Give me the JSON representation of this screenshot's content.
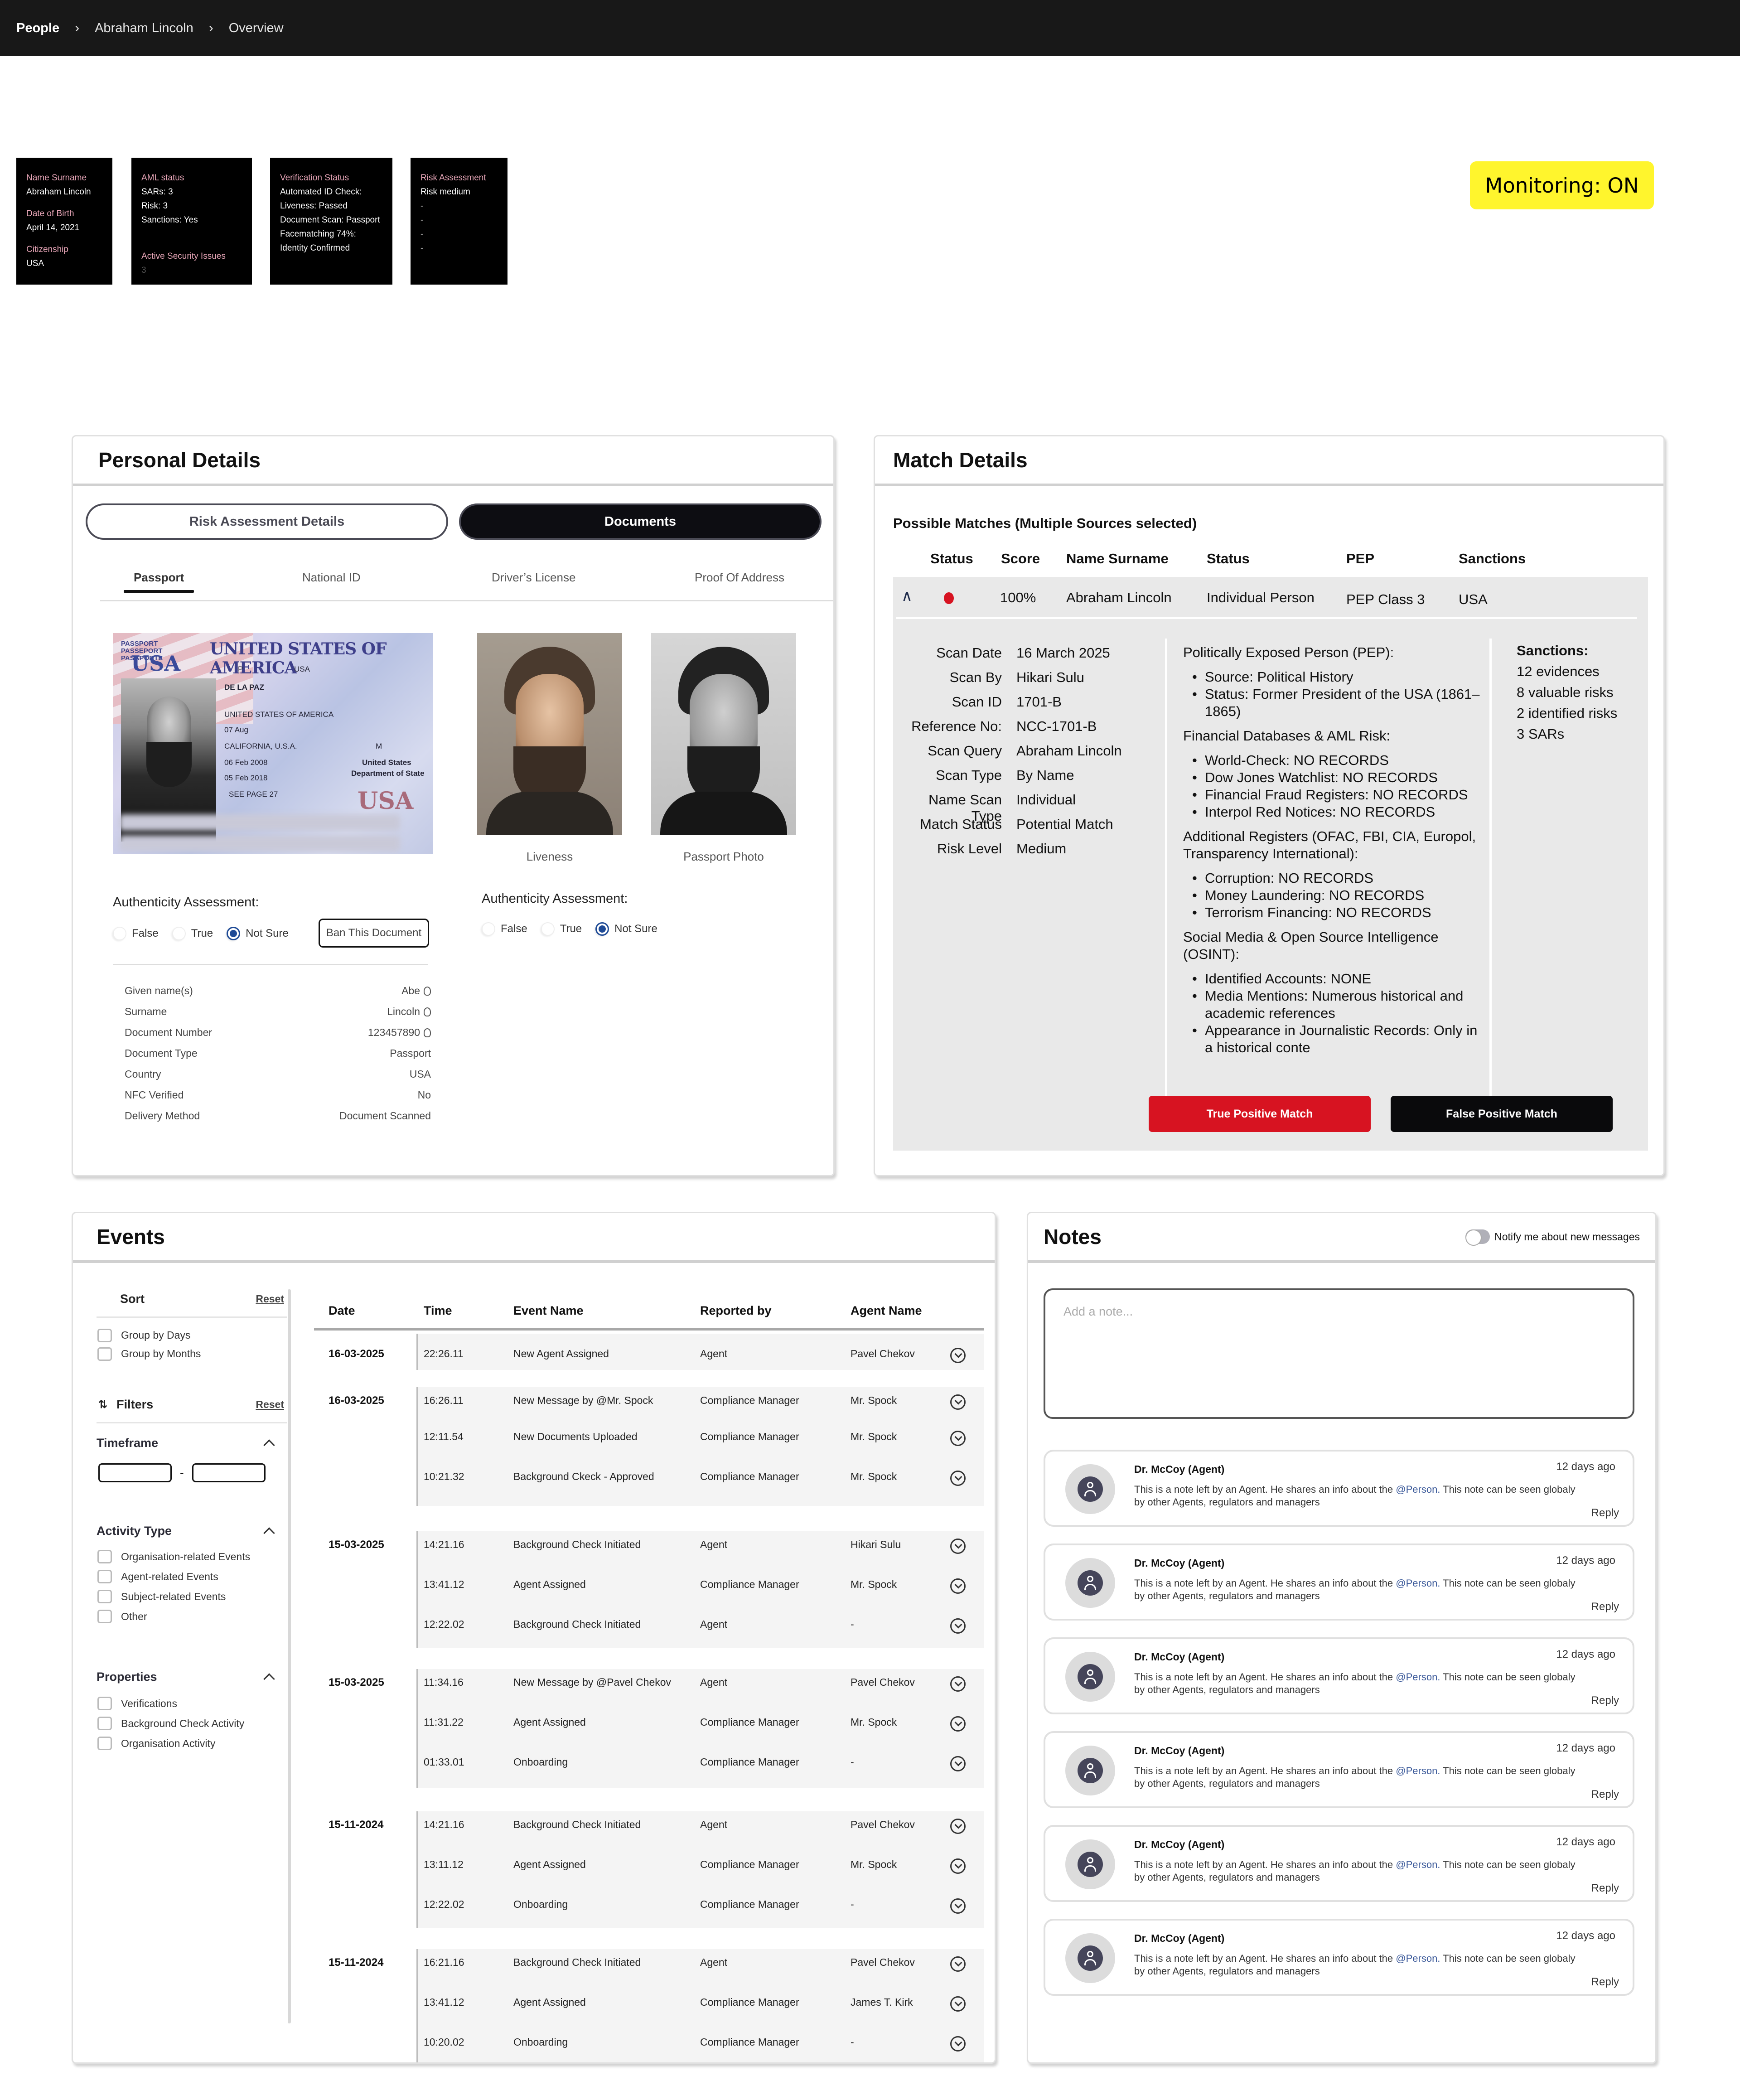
{
  "breadcrumb": [
    "People",
    "Abraham Lincoln",
    "Overview"
  ],
  "summary_cards": {
    "identity": {
      "name_label": "Name Surname",
      "name_value": "Abraham Lincoln",
      "dob_label": "Date of Birth",
      "dob_value": "April 14, 2021",
      "citizenship_label": "Citizenship",
      "citizenship_value": "USA"
    },
    "aml": {
      "title": "AML status",
      "lines": [
        "SARs: 3",
        "Risk: 3",
        "Sanctions: Yes"
      ],
      "security_label": "Active Security Issues",
      "security_value": "3"
    },
    "verification": {
      "title": "Verification Status",
      "lines": [
        "Automated ID Check:",
        "Liveness: Passed",
        "Document Scan: Passport",
        "Facematching 74%:",
        "Identity Confirmed"
      ]
    },
    "risk": {
      "title": "Risk Assessment",
      "lines": [
        "Risk medium",
        "-",
        "-",
        "-",
        "-"
      ]
    }
  },
  "monitoring_badge": {
    "label": "Monitoring: ON",
    "color": "#fff52d"
  },
  "personal_details": {
    "title": "Personal Details",
    "segments": [
      {
        "label": "Risk Assessment Details",
        "active": false
      },
      {
        "label": "Documents",
        "active": true
      }
    ],
    "doc_tabs": [
      {
        "label": "Passport",
        "active": true
      },
      {
        "label": "National ID"
      },
      {
        "label": "Driver’s License"
      },
      {
        "label": "Proof Of Address"
      }
    ],
    "passport_image": {
      "header": "UNITED STATES OF AMERICA",
      "side_labels": [
        "PASSPORT",
        "PASSEPORT",
        "PASAPORTE"
      ],
      "type": "P",
      "code": "USA",
      "surname": "DE LA PAZ",
      "nationality": "UNITED STATES OF AMERICA",
      "dob": "07 Aug",
      "place_of_birth": "CALIFORNIA, U.S.A.",
      "sex": "M",
      "issue_date": "06 Feb 2008",
      "expiry_date": "05 Feb 2018",
      "authority_line1": "United States",
      "authority_line2": "Department of State",
      "endorsements": "SEE PAGE 27",
      "emblem": "USA"
    },
    "photo_captions": {
      "liveness": "Liveness",
      "passport": "Passport Photo"
    },
    "authenticity": {
      "label": "Authenticity Assessment:",
      "options": [
        "False",
        "True",
        "Not Sure"
      ],
      "selected_left": "Not Sure",
      "selected_right": "Not Sure"
    },
    "ban_button": "Ban This Document",
    "fields": [
      {
        "label": "Given name(s)",
        "value": "Abe",
        "copy": true
      },
      {
        "label": "Surname",
        "value": "Lincoln",
        "copy": true
      },
      {
        "label": "Document Number",
        "value": "123457890",
        "copy": true
      },
      {
        "label": "Document Type",
        "value": "Passport",
        "copy": false
      },
      {
        "label": "Country",
        "value": "USA",
        "copy": false
      },
      {
        "label": "NFC Verified",
        "value": "No",
        "copy": false
      },
      {
        "label": "Delivery Method",
        "value": "Document Scanned",
        "copy": false
      }
    ]
  },
  "match_details": {
    "title": "Match Details",
    "subtitle": "Possible Matches (Multiple Sources selected)",
    "columns": [
      "Status",
      "Score",
      "Name Surname",
      "Status",
      "PEP",
      "Sanctions"
    ],
    "row": {
      "status_color": "#d71321",
      "score": "100%",
      "name": "Abraham Lincoln",
      "entity": "Individual Person",
      "pep": "PEP Class 3",
      "sanctions": "USA"
    },
    "scan": [
      {
        "k": "Scan Date",
        "v": "16 March 2025"
      },
      {
        "k": "Scan By",
        "v": "Hikari Sulu"
      },
      {
        "k": "Scan ID",
        "v": "1701-B"
      },
      {
        "k": "Reference No:",
        "v": "NCC-1701-B"
      },
      {
        "k": "Scan Query",
        "v": "Abraham Lincoln"
      },
      {
        "k": "Scan Type",
        "v": "By Name"
      },
      {
        "k": "Name Scan Type",
        "v": "Individual"
      },
      {
        "k": "Match Status",
        "v": "Potential Match"
      },
      {
        "k": "Risk Level",
        "v": "Medium"
      }
    ],
    "sections": [
      {
        "title": "Politically Exposed Person (PEP):",
        "items": [
          "Source: Political History",
          "Status: Former President of the USA (1861–1865)"
        ]
      },
      {
        "title": "Financial Databases & AML Risk:",
        "items": [
          "World-Check: NO RECORDS",
          "Dow Jones Watchlist: NO RECORDS",
          "Financial Fraud Registers: NO RECORDS",
          "Interpol Red Notices: NO RECORDS"
        ]
      },
      {
        "title": "Additional Registers (OFAC, FBI, CIA, Europol, Transparency International):",
        "items": [
          "Corruption: NO RECORDS",
          "Money Laundering: NO RECORDS",
          "Terrorism Financing: NO RECORDS"
        ]
      },
      {
        "title": "Social Media & Open Source Intelligence (OSINT):",
        "items": [
          "Identified Accounts: NONE",
          "Media Mentions: Numerous historical and academic references",
          "Appearance in Journalistic Records: Only in a historical conte"
        ]
      }
    ],
    "sanctions": {
      "title": "Sanctions:",
      "lines": [
        "12 evidences",
        "8 valuable risks",
        "2 identified risks",
        "3 SARs"
      ]
    },
    "buttons": {
      "true_positive": "True Positive Match",
      "false_positive": "False Positive Match"
    }
  },
  "events": {
    "title": "Events",
    "sort": {
      "label": "Sort",
      "reset": "Reset",
      "options": [
        "Group by Days",
        "Group by Months"
      ]
    },
    "filters": {
      "label": "Filters",
      "reset": "Reset"
    },
    "timeframe": {
      "label": "Timeframe",
      "from": "",
      "to": "",
      "separator": "-"
    },
    "activity_type": {
      "label": "Activity Type",
      "options": [
        "Organisation-related Events",
        "Agent-related Events",
        "Subject-related Events",
        "Other"
      ]
    },
    "properties": {
      "label": "Properties",
      "options": [
        "Verifications",
        "Background Check Activity",
        "Organisation  Activity"
      ]
    },
    "columns": [
      "Date",
      "Time",
      "Event Name",
      "Reported by",
      "Agent Name"
    ],
    "groups": [
      {
        "date": "16-03-2025",
        "rows": [
          {
            "time": "22:26.11",
            "event": "New Agent Assigned",
            "reported_by": "Agent",
            "agent": "Pavel Chekov"
          }
        ]
      },
      {
        "date": "16-03-2025",
        "rows": [
          {
            "time": "16:26.11",
            "event": "New Message by @Mr. Spock",
            "reported_by": "Compliance Manager",
            "agent": "Mr. Spock"
          },
          {
            "time": "12:11.54",
            "event": "New Documents Uploaded",
            "reported_by": "Compliance Manager",
            "agent": "Mr. Spock"
          },
          {
            "time": "10:21.32",
            "event": "Background Ckeck - Approved",
            "reported_by": "Compliance Manager",
            "agent": "Mr. Spock"
          }
        ]
      },
      {
        "date": "15-03-2025",
        "rows": [
          {
            "time": "14:21.16",
            "event": "Background Check Initiated",
            "reported_by": "Agent",
            "agent": "Hikari Sulu"
          },
          {
            "time": "13:41.12",
            "event": "Agent Assigned",
            "reported_by": "Compliance Manager",
            "agent": "Mr. Spock"
          },
          {
            "time": "12:22.02",
            "event": "Background Check Initiated",
            "reported_by": "Agent",
            "agent": "-"
          }
        ]
      },
      {
        "date": "15-03-2025",
        "rows": [
          {
            "time": "11:34.16",
            "event": "New Message by @Pavel Chekov",
            "reported_by": "Agent",
            "agent": "Pavel Chekov"
          },
          {
            "time": "11:31.22",
            "event": "Agent Assigned",
            "reported_by": "Compliance Manager",
            "agent": "Mr. Spock"
          },
          {
            "time": "01:33.01",
            "event": "Onboarding",
            "reported_by": "Compliance Manager",
            "agent": "-"
          }
        ]
      },
      {
        "date": "15-11-2024",
        "rows": [
          {
            "time": "14:21.16",
            "event": "Background Check Initiated",
            "reported_by": "Agent",
            "agent": "Pavel Chekov"
          },
          {
            "time": "13:11.12",
            "event": "Agent Assigned",
            "reported_by": "Compliance Manager",
            "agent": "Mr. Spock"
          },
          {
            "time": "12:22.02",
            "event": "Onboarding",
            "reported_by": "Compliance Manager",
            "agent": "-"
          }
        ]
      },
      {
        "date": "15-11-2024",
        "rows": [
          {
            "time": "16:21.16",
            "event": "Background Check Initiated",
            "reported_by": "Agent",
            "agent": "Pavel Chekov"
          },
          {
            "time": "13:41.12",
            "event": "Agent Assigned",
            "reported_by": "Compliance Manager",
            "agent": "James T. Kirk"
          },
          {
            "time": "10:20.02",
            "event": "Onboarding",
            "reported_by": "Compliance Manager",
            "agent": "-"
          }
        ]
      }
    ]
  },
  "notes": {
    "title": "Notes",
    "notify_label": "Notify me about new messages",
    "notify_on": false,
    "input_placeholder": "Add a note...",
    "input_value": "",
    "items": [
      {
        "author": "Dr. McCoy  (Agent)",
        "time": "12 days ago",
        "text_before": "This is a note left by an Agent. He shares an info about the ",
        "mention": "@Person.",
        "text_after": " This note can be seen globaly by other Agents, regulators and managers",
        "reply": "Reply"
      },
      {
        "author": "Dr. McCoy  (Agent)",
        "time": "12 days ago",
        "text_before": "This is a note left by an Agent. He shares an info about the ",
        "mention": "@Person.",
        "text_after": " This note can be seen globaly by other Agents, regulators and managers",
        "reply": "Reply"
      },
      {
        "author": "Dr. McCoy  (Agent)",
        "time": "12 days ago",
        "text_before": "This is a note left by an Agent. He shares an info about the ",
        "mention": "@Person.",
        "text_after": " This note can be seen globaly by other Agents, regulators and managers",
        "reply": "Reply"
      },
      {
        "author": "Dr. McCoy  (Agent)",
        "time": "12 days ago",
        "text_before": "This is a note left by an Agent. He shares an info about the ",
        "mention": "@Person.",
        "text_after": " This note can be seen globaly by other Agents, regulators and managers",
        "reply": "Reply"
      },
      {
        "author": "Dr. McCoy  (Agent)",
        "time": "12 days ago",
        "text_before": "This is a note left by an Agent. He shares an info about the ",
        "mention": "@Person.",
        "text_after": " This note can be seen globaly by other Agents, regulators and managers",
        "reply": "Reply"
      },
      {
        "author": "Dr. McCoy  (Agent)",
        "time": "12 days ago",
        "text_before": "This is a note left by an Agent. He shares an info about the ",
        "mention": "@Person.",
        "text_after": " This note can be seen globaly by other Agents, regulators and managers",
        "reply": "Reply"
      }
    ]
  }
}
